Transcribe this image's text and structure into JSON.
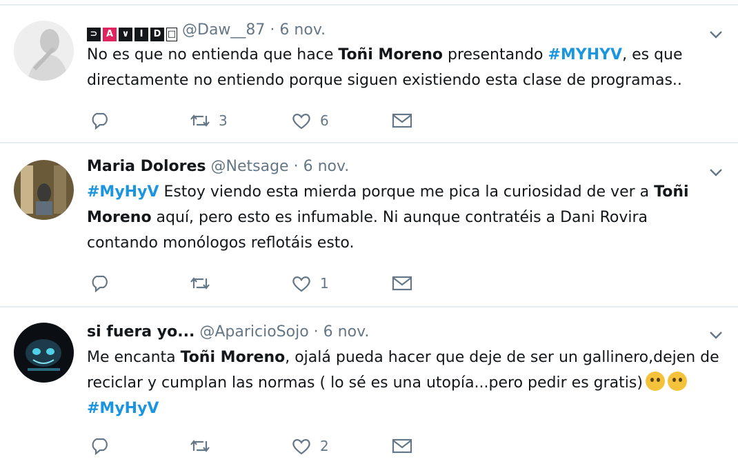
{
  "tweets": [
    {
      "name_letters": [
        "⊃",
        "A",
        "∨",
        "I",
        "D",
        "□"
      ],
      "handle": "@Daw__87",
      "dot": "·",
      "time": "6 nov.",
      "text": {
        "p1": "No es que no entienda que hace ",
        "b1": "Toñi Moreno",
        "p2": " presentando ",
        "h1": "#MYHYV",
        "p3": ", es que directamente no entiendo porque siguen existiendo esta clase de programas.."
      },
      "replies": "",
      "retweets": "3",
      "likes": "6"
    },
    {
      "name": "Maria Dolores",
      "handle": "@Netsage",
      "dot": "·",
      "time": "6 nov.",
      "text": {
        "h1": "#MyHyV",
        "p1": " Estoy viendo esta mierda porque me pica la curiosidad de ver a ",
        "b1": "Toñi Moreno",
        "p2": " aquí, pero esto es infumable. Ni aunque contratéis a Dani Rovira contando monólogos reflotáis esto."
      },
      "replies": "",
      "retweets": "",
      "likes": "1"
    },
    {
      "name": "si fuera yo...",
      "handle": "@AparicioSojo",
      "dot": "·",
      "time": "6 nov.",
      "text": {
        "p1": "Me encanta ",
        "b1": "Toñi Moreno",
        "p2": ", ojalá pueda hacer que deje de ser un gallinero,dejen de reciclar y cumplan las normas ( lo sé es una utopía...pero pedir es gratis)",
        "h1": "#MyHyV"
      },
      "replies": "",
      "retweets": "",
      "likes": "2"
    }
  ],
  "icons": {
    "reply": "reply-icon",
    "retweet": "retweet-icon",
    "like": "heart-icon",
    "dm": "envelope-icon",
    "more": "chevron-down-icon",
    "emoji": "rolling-eyes-emoji"
  },
  "colors": {
    "hashtag": "#1b95e0",
    "secondary_text": "#657786",
    "divider": "#e6ecf0",
    "icon": "#657786"
  }
}
